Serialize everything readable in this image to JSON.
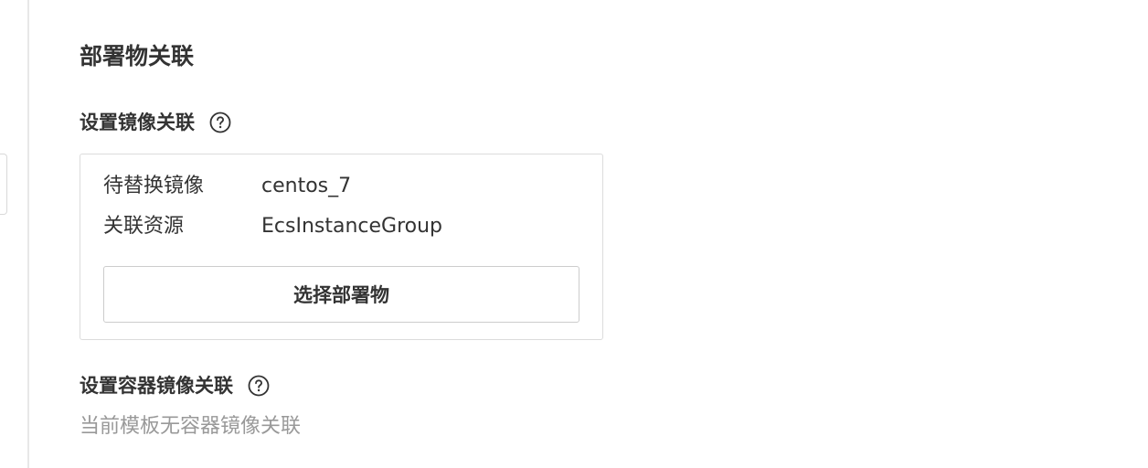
{
  "section": {
    "title": "部署物关联"
  },
  "image_binding": {
    "title": "设置镜像关联",
    "help_icon": "question-circle-icon",
    "rows": [
      {
        "key": "待替换镜像",
        "value": "centos_7"
      },
      {
        "key": "关联资源",
        "value": "EcsInstanceGroup"
      }
    ],
    "select_button_label": "选择部署物"
  },
  "container_binding": {
    "title": "设置容器镜像关联",
    "help_icon": "question-circle-icon",
    "empty_text": "当前模板无容器镜像关联"
  }
}
